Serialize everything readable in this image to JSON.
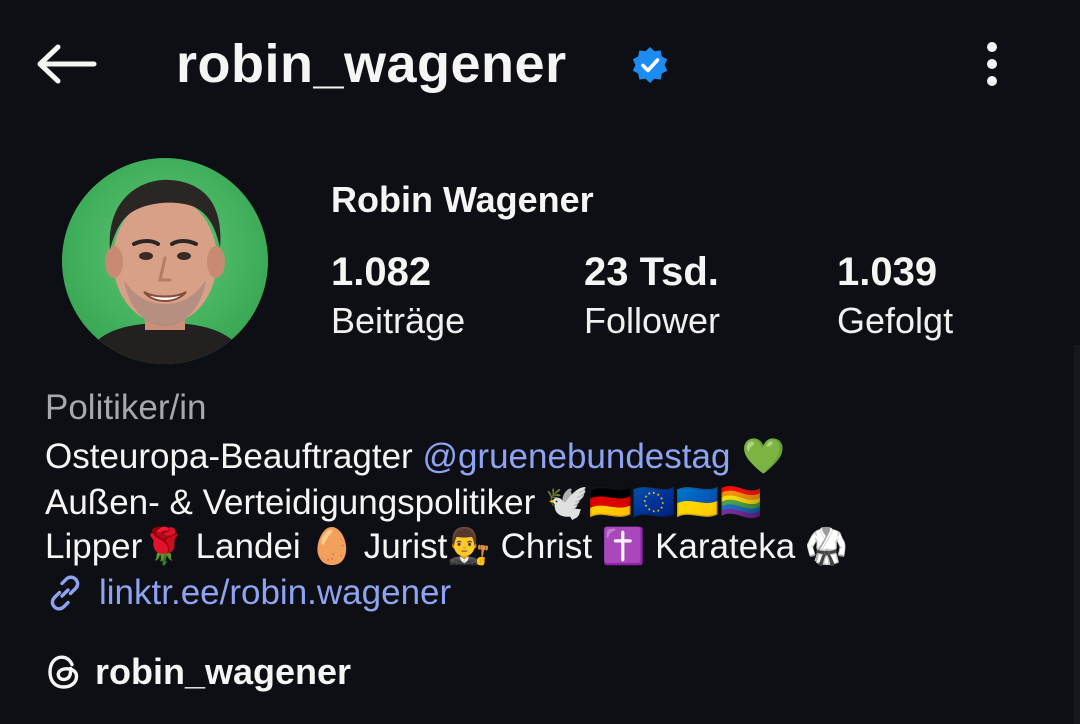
{
  "header": {
    "username": "robin_wagener",
    "back_icon": "arrow-left-icon",
    "verified_icon": "verified-badge-icon",
    "more_icon": "more-vertical-icon"
  },
  "profile": {
    "display_name": "Robin Wagener",
    "stats": [
      {
        "value": "1.082",
        "label": "Beiträge"
      },
      {
        "value": "23 Tsd.",
        "label": "Follower"
      },
      {
        "value": "1.039",
        "label": "Gefolgt"
      }
    ]
  },
  "bio": {
    "category": "Politiker/in",
    "line1_text": "Osteuropa-Beauftragter ",
    "line1_mention": "@gruenebundestag",
    "line1_emoji": " 💚",
    "line2_text": "Außen- & Verteidigungspolitiker ",
    "line2_emoji": "🕊️🇩🇪🇪🇺🇺🇦🏳️‍🌈",
    "line3_text": "Lipper🌹 Landei 🥚 Jurist👨‍⚖️ Christ ✝️ Karateka 🥋",
    "link": "linktr.ee/robin.wagener",
    "link_icon": "link-icon"
  },
  "threads": {
    "icon": "threads-icon",
    "username": "robin_wagener"
  },
  "colors": {
    "background": "#0d0f14",
    "link": "#8ea4f2",
    "verified": "#1d8cf0",
    "muted": "#a6a8ae"
  }
}
